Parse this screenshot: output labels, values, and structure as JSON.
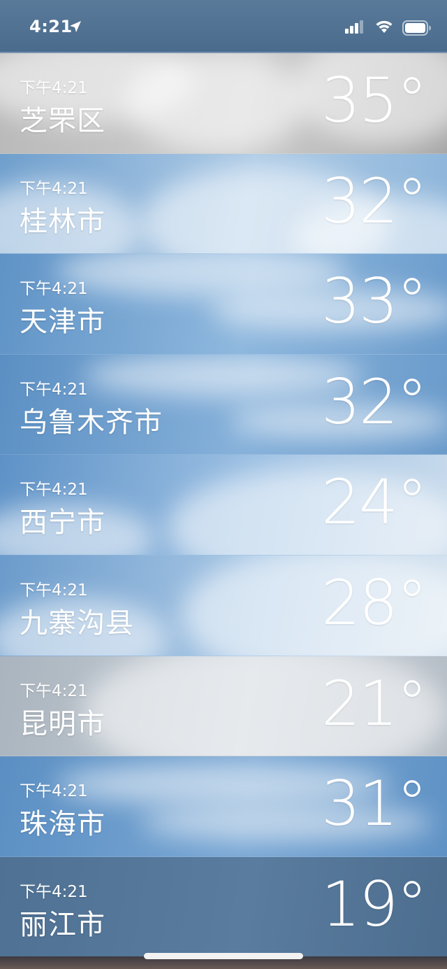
{
  "status_bar": {
    "time": "4:21",
    "icons": [
      "location-arrow-icon",
      "cellular-signal-icon",
      "wifi-icon",
      "battery-icon"
    ]
  },
  "cities": [
    {
      "time": "下午4:21",
      "name": "芝罘区",
      "temp": "35°",
      "bg": [
        "#b9b9b9",
        "#cfcfcf",
        "#a7a7a7"
      ]
    },
    {
      "time": "下午4:21",
      "name": "桂林市",
      "temp": "32°",
      "bg": [
        "#6f9fcd",
        "#aecbe6",
        "#8db5da"
      ]
    },
    {
      "time": "下午4:21",
      "name": "天津市",
      "temp": "33°",
      "bg": [
        "#5f93c6",
        "#8fb8de",
        "#6b9ccc"
      ]
    },
    {
      "time": "下午4:21",
      "name": "乌鲁木齐市",
      "temp": "32°",
      "bg": [
        "#5b8fc3",
        "#86b1da",
        "#6a9bcb"
      ]
    },
    {
      "time": "下午4:21",
      "name": "西宁市",
      "temp": "24°",
      "bg": [
        "#5e92c7",
        "#9cc0e3",
        "#c9dbec"
      ]
    },
    {
      "time": "下午4:21",
      "name": "九寨沟县",
      "temp": "28°",
      "bg": [
        "#6b9bcb",
        "#a8c7e5",
        "#d5e3ef"
      ]
    },
    {
      "time": "下午4:21",
      "name": "昆明市",
      "temp": "21°",
      "bg": [
        "#aab4be",
        "#c8d0d7",
        "#b4bcc5"
      ]
    },
    {
      "time": "下午4:21",
      "name": "珠海市",
      "temp": "31°",
      "bg": [
        "#5b8fc3",
        "#79a7d4",
        "#5f92c5"
      ]
    },
    {
      "time": "下午4:21",
      "name": "丽江市",
      "temp": "19°",
      "bg": [
        "#4f7193",
        "#5a7c9e",
        "#4c6d8e"
      ]
    }
  ]
}
